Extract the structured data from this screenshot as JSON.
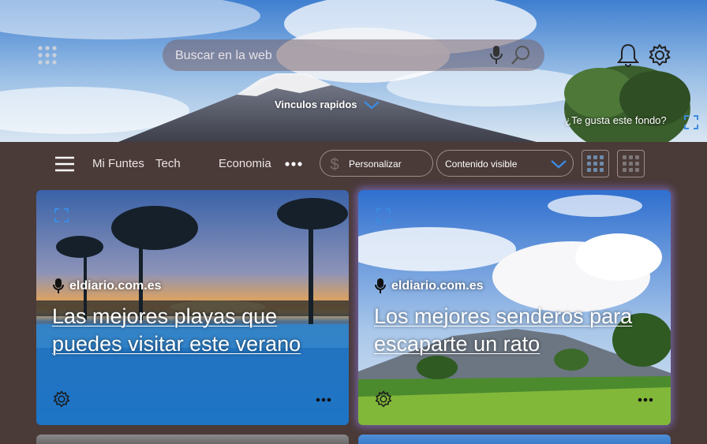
{
  "header": {
    "search_placeholder": "Buscar en la web",
    "quick_links_label": "Vinculos rapidos",
    "background_question": "¿Te gusta este fondo?"
  },
  "icons": {
    "apps": "apps-grid-icon",
    "mic": "microphone-icon",
    "search": "search-icon",
    "bell": "bell-icon",
    "settings": "gear-icon",
    "expand": "expand-icon"
  },
  "nav": {
    "links": [
      "Mi Funtes",
      "Tech",
      "Economia"
    ],
    "personalize_label": "Personalizar",
    "content_visible_label": "Contenido visible"
  },
  "cards": [
    {
      "source": "eldiario.com.es",
      "headline": "Las mejores playas que puedes visitar este verano"
    },
    {
      "source": "eldiario.com.es",
      "headline": "Los mejores senderos para escaparte un rato"
    }
  ],
  "colors": {
    "nav_background": "#4a3a38",
    "accent": "#3b8be0",
    "card_highlight": "#9682ff"
  }
}
